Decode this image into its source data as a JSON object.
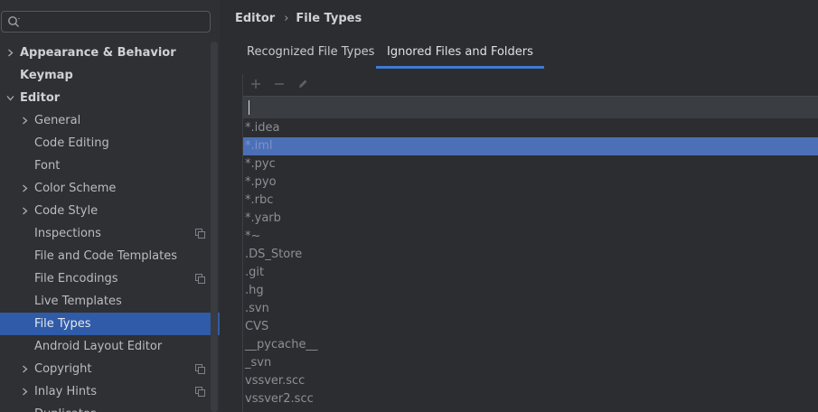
{
  "search": {
    "placeholder": ""
  },
  "sidebar": {
    "items": [
      {
        "label": "Appearance & Behavior",
        "level": 0,
        "expandable": true,
        "expanded": false,
        "bold": true
      },
      {
        "label": "Keymap",
        "level": 0,
        "expandable": false,
        "bold": true
      },
      {
        "label": "Editor",
        "level": 0,
        "expandable": true,
        "expanded": true,
        "bold": true
      },
      {
        "label": "General",
        "level": 1,
        "expandable": true,
        "expanded": false
      },
      {
        "label": "Code Editing",
        "level": 1,
        "expandable": false
      },
      {
        "label": "Font",
        "level": 1,
        "expandable": false
      },
      {
        "label": "Color Scheme",
        "level": 1,
        "expandable": true,
        "expanded": false
      },
      {
        "label": "Code Style",
        "level": 1,
        "expandable": true,
        "expanded": false
      },
      {
        "label": "Inspections",
        "level": 1,
        "expandable": false,
        "project_icon": true
      },
      {
        "label": "File and Code Templates",
        "level": 1,
        "expandable": false
      },
      {
        "label": "File Encodings",
        "level": 1,
        "expandable": false,
        "project_icon": true
      },
      {
        "label": "Live Templates",
        "level": 1,
        "expandable": false
      },
      {
        "label": "File Types",
        "level": 1,
        "expandable": false,
        "selected": true
      },
      {
        "label": "Android Layout Editor",
        "level": 1,
        "expandable": false
      },
      {
        "label": "Copyright",
        "level": 1,
        "expandable": true,
        "expanded": false,
        "project_icon": true
      },
      {
        "label": "Inlay Hints",
        "level": 1,
        "expandable": true,
        "expanded": false,
        "project_icon": true
      },
      {
        "label": "Duplicates",
        "level": 1,
        "expandable": false
      }
    ]
  },
  "breadcrumb": {
    "parent": "Editor",
    "separator": "›",
    "current": "File Types"
  },
  "tabs": [
    {
      "label": "Recognized File Types",
      "active": false
    },
    {
      "label": "Ignored Files and Folders",
      "active": true
    }
  ],
  "toolbar": {
    "add_icon": "plus-icon",
    "remove_icon": "minus-icon",
    "edit_icon": "pencil-icon"
  },
  "edit_value": "",
  "ignored": [
    "*.idea",
    "*.iml",
    "*.pyc",
    "*.pyo",
    "*.rbc",
    "*.yarb",
    "*~",
    ".DS_Store",
    ".git",
    ".hg",
    ".svn",
    "CVS",
    "__pycache__",
    "_svn",
    "vssver.scc",
    "vssver2.scc"
  ],
  "selected_ignored_index": 1,
  "colors": {
    "accent": "#3f7ad6",
    "selection": "#2f5ba8",
    "list_selection": "#4c70b8",
    "background": "#2b2d30"
  }
}
